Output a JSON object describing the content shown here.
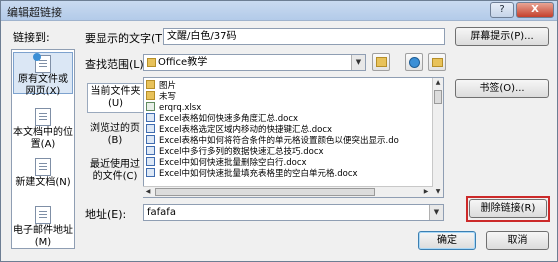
{
  "window": {
    "title": "编辑超链接",
    "help_label": "?",
    "close_label": "X"
  },
  "link_to_label": "链接到:",
  "link_types": [
    {
      "label": "原有文件或网页(X)"
    },
    {
      "label": "本文档中的位置(A)"
    },
    {
      "label": "新建文档(N)"
    },
    {
      "label": "电子邮件地址(M)"
    }
  ],
  "display_text": {
    "label": "要显示的文字(T):",
    "value": "文醒/白色/37码"
  },
  "screen_tip_label": "屏幕提示(P)...",
  "look_in": {
    "label": "查找范围(L):",
    "value": "Office教学"
  },
  "browse_tabs": [
    {
      "label": "当前文件夹(U)"
    },
    {
      "label": "浏览过的页(B)"
    },
    {
      "label": "最近使用过的文件(C)"
    }
  ],
  "files": [
    {
      "name": "图片",
      "type": "folder"
    },
    {
      "name": "未写",
      "type": "folder"
    },
    {
      "name": "erqrq.xlsx",
      "type": "xls"
    },
    {
      "name": "Excel表格如何快速多角度汇总.docx",
      "type": "doc"
    },
    {
      "name": "Excel表格选定区域内移动的快捷键汇总.docx",
      "type": "doc"
    },
    {
      "name": "Excel表格中如何将符合条件的单元格设置颜色以便突出显示.do",
      "type": "doc"
    },
    {
      "name": "Excel中多行多列的数据快速汇总技巧.docx",
      "type": "doc"
    },
    {
      "name": "Excel中如何快速批量删除空白行.docx",
      "type": "doc"
    },
    {
      "name": "Excel中如何快速批量填充表格里的空白单元格.docx",
      "type": "doc"
    }
  ],
  "bookmark_label": "书签(O)...",
  "address": {
    "label": "地址(E):",
    "value": "fafafa"
  },
  "remove_link_label": "删除链接(R)",
  "ok_label": "确定",
  "cancel_label": "取消",
  "colors": {
    "accent": "#3c7fb1",
    "highlight": "#cc2a2a"
  }
}
